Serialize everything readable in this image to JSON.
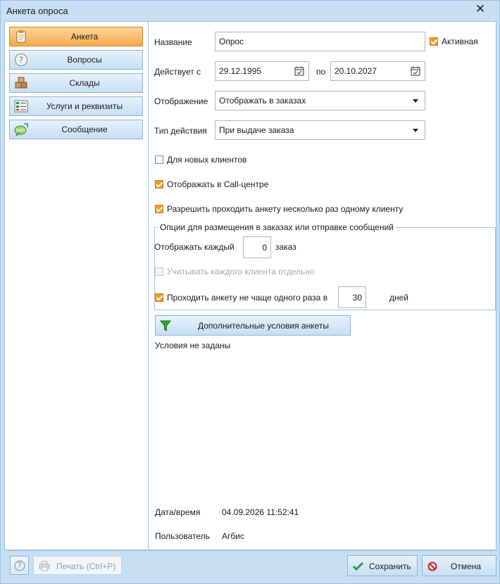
{
  "window": {
    "title": "Анкета опроса",
    "close_glyph": "✕"
  },
  "nav": {
    "items": [
      {
        "label": "Анкета",
        "icon": "clipboard-icon",
        "active": true
      },
      {
        "label": "Вопросы",
        "icon": "question-icon",
        "active": false
      },
      {
        "label": "Склады",
        "icon": "boxes-icon",
        "active": false
      },
      {
        "label": "Услуги и реквизиты",
        "icon": "services-list-icon",
        "active": false
      },
      {
        "label": "Сообщение",
        "icon": "sms-icon",
        "active": false
      }
    ]
  },
  "form": {
    "name_label": "Название",
    "name_value": "Опрос",
    "active_label": "Активная",
    "active_checked": true,
    "valid_from_label": "Действует с",
    "valid_from": "29.12.1995",
    "valid_to_label": "по",
    "valid_to": "20.10.2027",
    "display_label": "Отображение",
    "display_value": "Отображать в заказах",
    "action_type_label": "Тип действия",
    "action_type_value": "При выдаче заказа",
    "new_clients_label": "Для новых клиентов",
    "new_clients_checked": false,
    "callcenter_label": "Отображать в Call-центре",
    "callcenter_checked": true,
    "multiple_label": "Разрешить проходить анкету несколько раз одному клиенту",
    "multiple_checked": true
  },
  "options_group": {
    "title": "Опции для размещения в заказах или отправке сообщений",
    "show_every_label": "Отображать каждый",
    "show_every_value": "0",
    "show_every_unit": "заказ",
    "per_client_label": "Учитывать каждого клиента отдельно",
    "per_client_checked": false,
    "limit_label": "Проходить анкету не чаще одного раза в",
    "limit_checked": true,
    "limit_value": "30",
    "limit_unit": "дней"
  },
  "conditions": {
    "button_label": "Дополнительные условия анкеты",
    "status_text": "Условия не заданы"
  },
  "meta": {
    "datetime_label": "Дата/время",
    "datetime_value": "04.09.2026 11:52:41",
    "user_label": "Пользователь",
    "user_value": "Агбис"
  },
  "footer": {
    "help_glyph": "?",
    "print_label": "Печать (Ctrl+P)",
    "save_label": "Сохранить",
    "cancel_label": "Отмена"
  },
  "colors": {
    "title_bg": "#c8dff3",
    "active_tab": "#f6a84a",
    "checkbox_on": "#f39a2b",
    "save_check": "#2e9e2e",
    "cancel_icon": "#d21f1f"
  }
}
